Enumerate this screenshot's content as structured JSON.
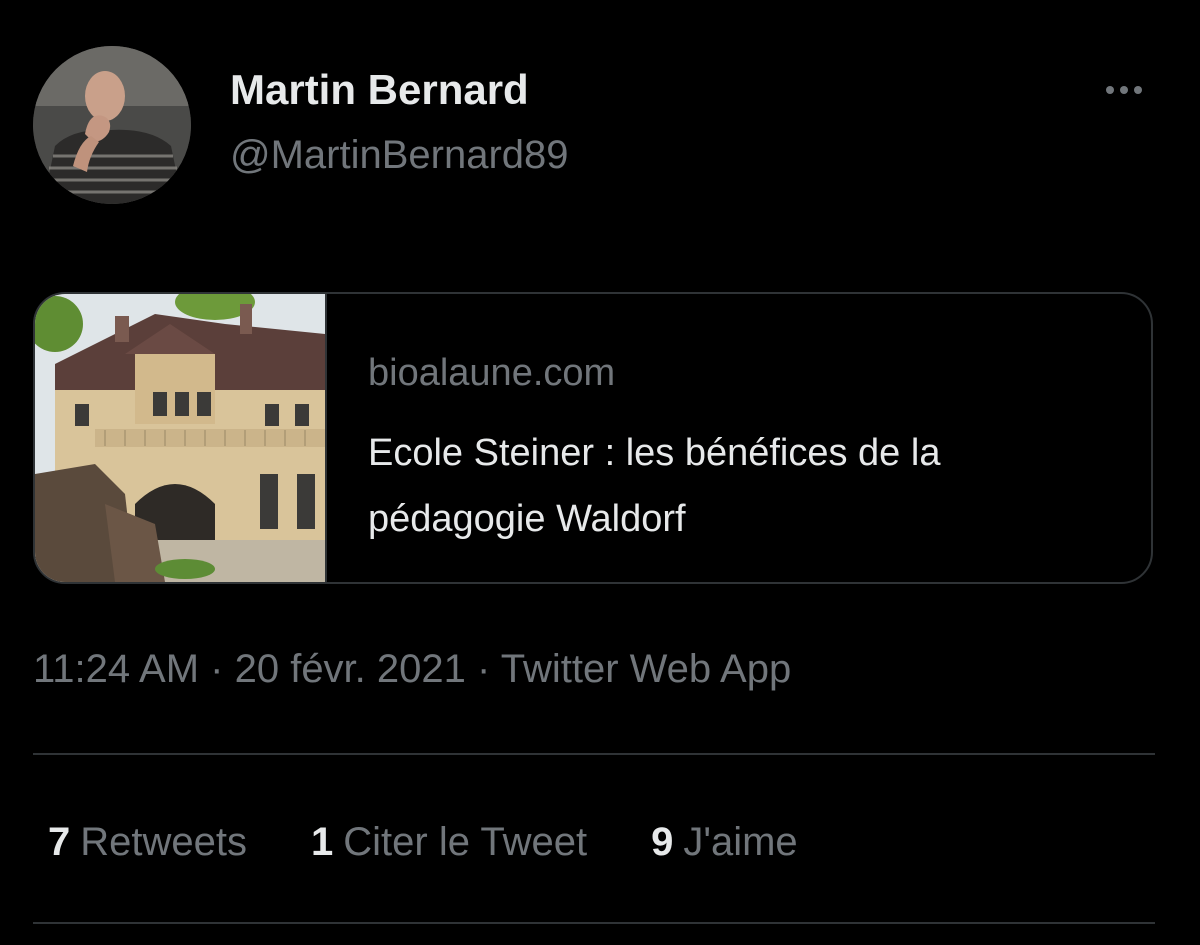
{
  "tweet": {
    "author": {
      "display_name": "Martin Bernard",
      "handle": "@MartinBernard89"
    },
    "more_icon": "more-horizontal-icon",
    "link_card": {
      "domain": "bioalaune.com",
      "title": "Ecole Steiner : les bénéfices de la pédagogie Waldorf"
    },
    "meta": {
      "time": "11:24 AM",
      "separator": " · ",
      "date": "20 févr. 2021",
      "source": "Twitter Web App"
    },
    "stats": {
      "retweets_count": "7",
      "retweets_label": "Retweets",
      "quotes_count": "1",
      "quotes_label": "Citer le Tweet",
      "likes_count": "9",
      "likes_label": "J'aime"
    }
  },
  "colors": {
    "background": "#000000",
    "primary_text": "#e7e9ea",
    "secondary_text": "#71767b",
    "border": "#2f3336"
  }
}
